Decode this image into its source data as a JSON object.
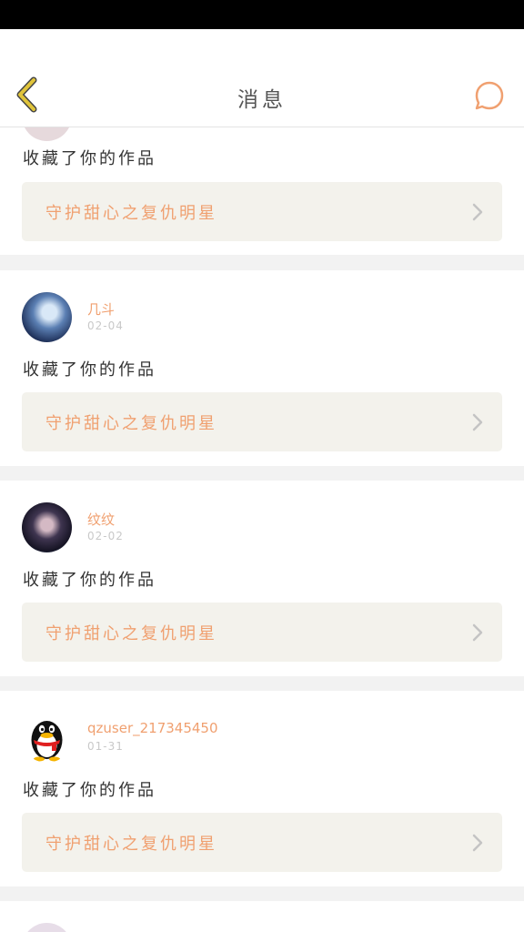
{
  "header": {
    "title": "消息"
  },
  "icons": {
    "back": "chevron-left-icon",
    "chat": "chat-bubble-icon",
    "item_arrow": "chevron-right-icon"
  },
  "colors": {
    "accent": "#f0a070",
    "back_icon": "#e0c43a",
    "card_bg": "#f3f2ec"
  },
  "notifications": [
    {
      "user": "",
      "date": "",
      "action": "收藏了你的作品",
      "work": "守护甜心之复仇明星"
    },
    {
      "user": "几斗",
      "date": "02-04",
      "action": "收藏了你的作品",
      "work": "守护甜心之复仇明星"
    },
    {
      "user": "纹纹",
      "date": "02-02",
      "action": "收藏了你的作品",
      "work": "守护甜心之复仇明星"
    },
    {
      "user": "qzuser_217345450",
      "date": "01-31",
      "action": "收藏了你的作品",
      "work": "守护甜心之复仇明星"
    }
  ]
}
